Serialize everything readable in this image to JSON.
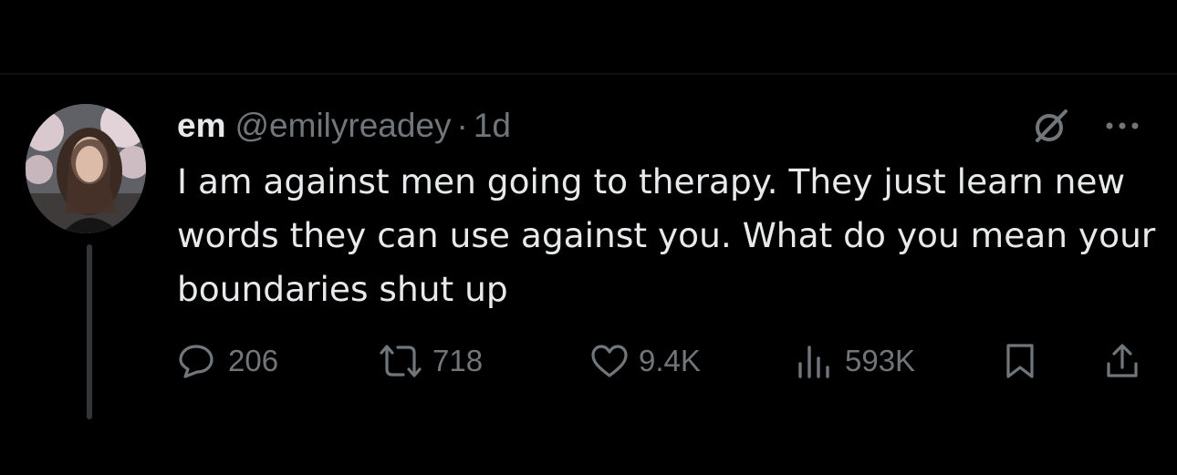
{
  "tweet": {
    "display_name": "em",
    "handle": "@emilyreadey",
    "separator": "·",
    "time": "1d",
    "text": "I am against men going to therapy. They just learn new words they can use against you. What do you mean your boundaries shut up",
    "stats": {
      "replies": "206",
      "reposts": "718",
      "likes": "9.4K",
      "views": "593K"
    }
  },
  "icons": {
    "header": [
      "grok-icon",
      "more-icon"
    ],
    "actions": [
      "reply-icon",
      "repost-icon",
      "like-icon",
      "views-icon",
      "bookmark-icon",
      "share-icon"
    ]
  },
  "colors": {
    "background": "#000000",
    "primary_text": "#e7e9ea",
    "secondary_text": "#71767b",
    "thread_line": "#333639"
  }
}
